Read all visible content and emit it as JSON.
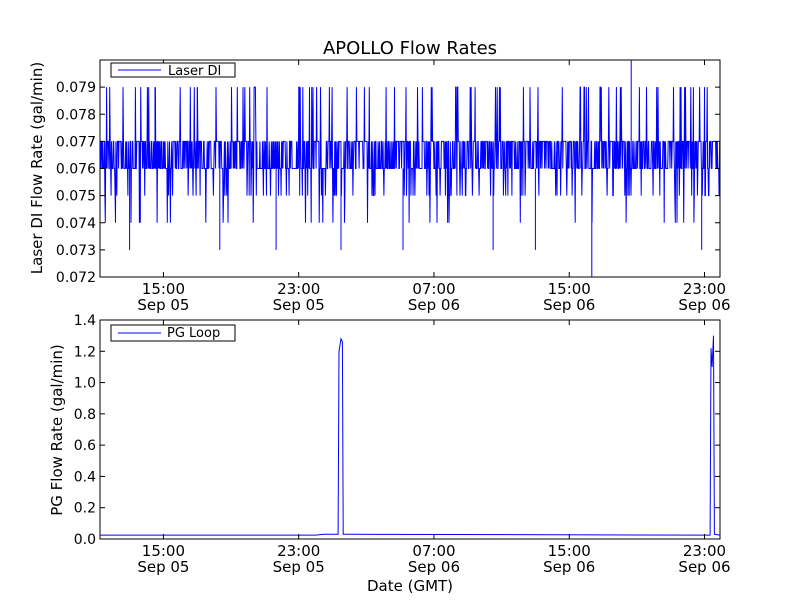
{
  "figure": {
    "title": "APOLLO Flow Rates",
    "shared_xlabel": "Date (GMT)"
  },
  "chart_data": [
    {
      "type": "line",
      "title": "APOLLO Flow Rates",
      "xlabel": "",
      "ylabel": "Laser DI Flow Rate (gal/min)",
      "xlim": [
        "2012-09-05 11:15",
        "2012-09-06 23:55"
      ],
      "ylim": [
        0.072,
        0.08
      ],
      "yticks": [
        0.072,
        0.073,
        0.074,
        0.075,
        0.076,
        0.077,
        0.078,
        0.079
      ],
      "ytick_labels": [
        "0.072",
        "0.073",
        "0.074",
        "0.075",
        "0.076",
        "0.077",
        "0.078",
        "0.079"
      ],
      "xticks": [
        "2012-09-05 15:00",
        "2012-09-05 23:00",
        "2012-09-06 07:00",
        "2012-09-06 15:00",
        "2012-09-06 23:00"
      ],
      "xtick_labels": [
        [
          "15:00",
          "Sep 05"
        ],
        [
          "23:00",
          "Sep 05"
        ],
        [
          "07:00",
          "Sep 06"
        ],
        [
          "15:00",
          "Sep 06"
        ],
        [
          "23:00",
          "Sep 06"
        ]
      ],
      "grid": false,
      "legend": "top-left",
      "series": [
        {
          "name": "Laser DI",
          "color": "#0000ff",
          "baseline_band": [
            0.076,
            0.077
          ],
          "x": [
            "2012-09-05 11:15",
            "2012-09-05 13:00",
            "2012-09-05 14:30",
            "2012-09-05 17:00",
            "2012-09-05 18:20",
            "2012-09-05 21:40",
            "2012-09-06 01:30",
            "2012-09-06 05:10",
            "2012-09-06 10:30",
            "2012-09-06 13:00",
            "2012-09-06 16:20",
            "2012-09-06 18:40",
            "2012-09-06 22:50",
            "2012-09-06 23:55"
          ],
          "y": [
            0.0765,
            0.073,
            0.079,
            0.079,
            0.073,
            0.073,
            0.073,
            0.073,
            0.073,
            0.073,
            0.072,
            0.08,
            0.073,
            0.0765
          ]
        }
      ]
    },
    {
      "type": "line",
      "title": "",
      "xlabel": "Date (GMT)",
      "ylabel": "PG Flow Rate (gal/min)",
      "xlim": [
        "2012-09-05 11:15",
        "2012-09-06 23:55"
      ],
      "ylim": [
        0.0,
        1.4
      ],
      "yticks": [
        0.0,
        0.2,
        0.4,
        0.6,
        0.8,
        1.0,
        1.2,
        1.4
      ],
      "ytick_labels": [
        "0.0",
        "0.2",
        "0.4",
        "0.6",
        "0.8",
        "1.0",
        "1.2",
        "1.4"
      ],
      "xticks": [
        "2012-09-05 15:00",
        "2012-09-05 23:00",
        "2012-09-06 07:00",
        "2012-09-06 15:00",
        "2012-09-06 23:00"
      ],
      "xtick_labels": [
        [
          "15:00",
          "Sep 05"
        ],
        [
          "23:00",
          "Sep 05"
        ],
        [
          "07:00",
          "Sep 06"
        ],
        [
          "15:00",
          "Sep 06"
        ],
        [
          "23:00",
          "Sep 06"
        ]
      ],
      "grid": false,
      "legend": "top-left",
      "series": [
        {
          "name": "PG Loop",
          "color": "#0000ff",
          "x": [
            "2012-09-05 11:15",
            "2012-09-06 00:00",
            "2012-09-06 00:30",
            "2012-09-06 01:20",
            "2012-09-06 01:23",
            "2012-09-06 01:30",
            "2012-09-06 01:35",
            "2012-09-06 01:38",
            "2012-09-06 02:00",
            "2012-09-06 23:00",
            "2012-09-06 23:20",
            "2012-09-06 23:23",
            "2012-09-06 23:27",
            "2012-09-06 23:32",
            "2012-09-06 23:35",
            "2012-09-06 23:55"
          ],
          "y": [
            0.025,
            0.025,
            0.03,
            0.03,
            1.2,
            1.28,
            1.26,
            0.03,
            0.03,
            0.025,
            0.025,
            1.22,
            1.1,
            1.3,
            0.03,
            0.025
          ]
        }
      ]
    }
  ]
}
